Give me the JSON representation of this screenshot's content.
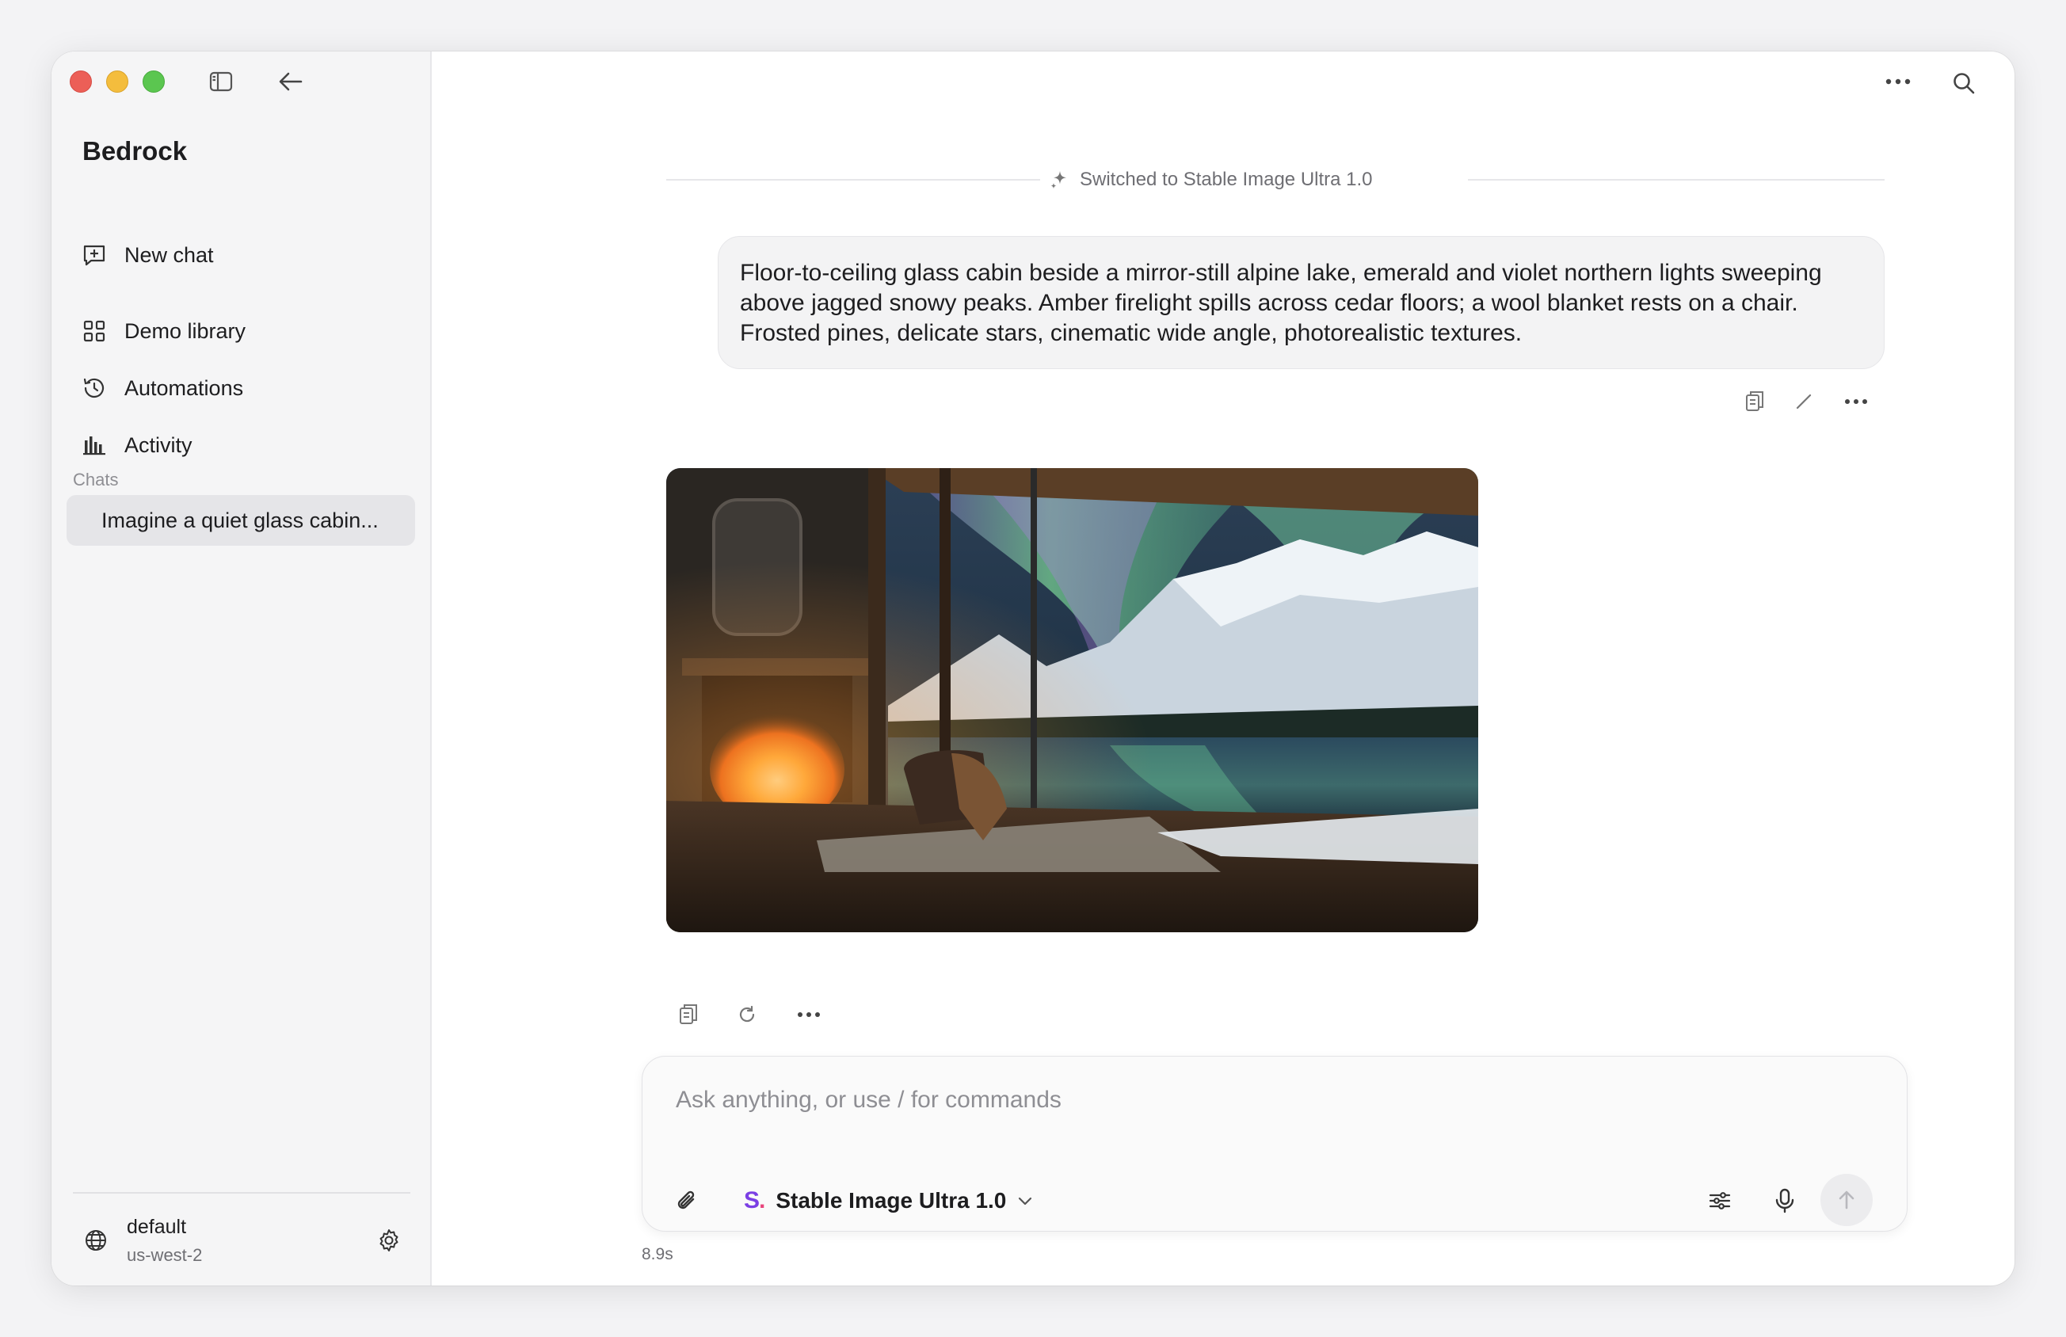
{
  "sidebar": {
    "app_title": "Bedrock",
    "nav": [
      {
        "label": "New chat",
        "icon": "new-chat-icon"
      },
      {
        "label": "Demo library",
        "icon": "grid-icon"
      },
      {
        "label": "Automations",
        "icon": "history-icon"
      },
      {
        "label": "Activity",
        "icon": "bar-chart-icon"
      }
    ],
    "chats_label": "Chats",
    "chats": [
      {
        "label": "Imagine a quiet glass cabin..."
      }
    ],
    "profile": {
      "name": "default",
      "region": "us-west-2"
    }
  },
  "conversation": {
    "model_switch_notice": "Switched to Stable Image Ultra 1.0",
    "user_prompt": "Floor-to-ceiling glass cabin beside a mirror-still alpine lake, emerald and violet northern lights sweeping above jagged snowy peaks. Amber firelight spills across cedar floors; a wool blanket rests on a chair. Frosted pines, delicate stars, cinematic wide angle, photorealistic textures."
  },
  "composer": {
    "placeholder": "Ask anything, or use / for commands",
    "value": "",
    "model_logo_letter": "S",
    "model_logo_dot": ".",
    "model_name": "Stable Image Ultra 1.0"
  },
  "footer": {
    "timing": "8.9s"
  },
  "colors": {
    "accent_purple": "#7b3fe4",
    "accent_pink": "#e8457c",
    "caret": "#2563eb"
  }
}
